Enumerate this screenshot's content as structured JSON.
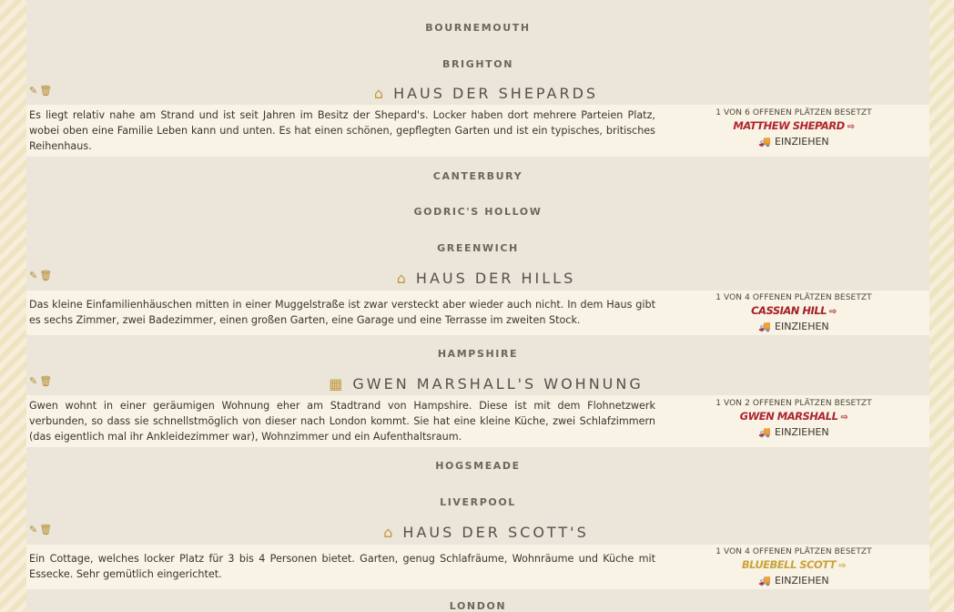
{
  "cities": [
    "BOURNEMOUTH",
    "BRIGHTON",
    "CANTERBURY",
    "GODRIC'S HOLLOW",
    "GREENWICH",
    "HAMPSHIRE",
    "HOGSMEADE",
    "LIVERPOOL",
    "LONDON"
  ],
  "tools": {
    "edit_icon": "✎",
    "delete_icon": "🗑"
  },
  "move_label": "EINZIEHEN",
  "houses": [
    {
      "icon": "home-icon",
      "title": "HAUS DER SHEPARDS",
      "description": "Es liegt relativ nahe am Strand und ist seit Jahren im Besitz der Shepard's. Locker haben dort mehrere Parteien Platz, wobei oben eine Familie Leben kann und unten. Es hat einen schönen, gepflegten Garten und ist ein typisches, britisches Reihenhaus.",
      "occupancy": "1 VON 6 OFFENEN PLÄTZEN BESETZT",
      "resident": "MATTHEW SHEPARD",
      "resident_color": "#b1262d"
    },
    {
      "icon": "home-icon",
      "title": "HAUS DER HILLS",
      "description": "Das kleine Einfamilienhäuschen mitten in einer Muggelstraße ist zwar versteckt aber wieder auch nicht. In dem Haus gibt es sechs Zimmer, zwei Badezimmer, einen großen Garten, eine Garage und eine Terrasse im zweiten Stock.",
      "occupancy": "1 VON 4 OFFENEN PLÄTZEN BESETZT",
      "resident": "CASSIAN HILL",
      "resident_color": "#a61f26"
    },
    {
      "icon": "building-icon",
      "title": "GWEN MARSHALL'S WOHNUNG",
      "description": "Gwen wohnt in einer geräumigen Wohnung eher am Stadtrand von Hampshire. Diese ist mit dem Flohnetzwerk verbunden, so dass sie schnellstmöglich von dieser nach London kommt. Sie hat eine kleine Küche, zwei Schlafzimmern (das eigentlich mal ihr Ankleidezimmer war), Wohnzimmer und ein Aufenthaltsraum.",
      "occupancy": "1 VON 2 OFFENEN PLÄTZEN BESETZT",
      "resident": "GWEN MARSHALL",
      "resident_color": "#ad2530"
    },
    {
      "icon": "home-icon",
      "title": "HAUS DER SCOTT'S",
      "description": "Ein Cottage, welches locker Platz für 3 bis 4 Personen bietet. Garten, genug Schlafräume, Wohnräume und Küche mit Essecke. Sehr gemütlich eingerichtet.",
      "occupancy": "1 VON 4 OFFENEN PLÄTZEN BESETZT",
      "resident": "BLUEBELL SCOTT",
      "resident_color": "#c9a43a"
    }
  ]
}
